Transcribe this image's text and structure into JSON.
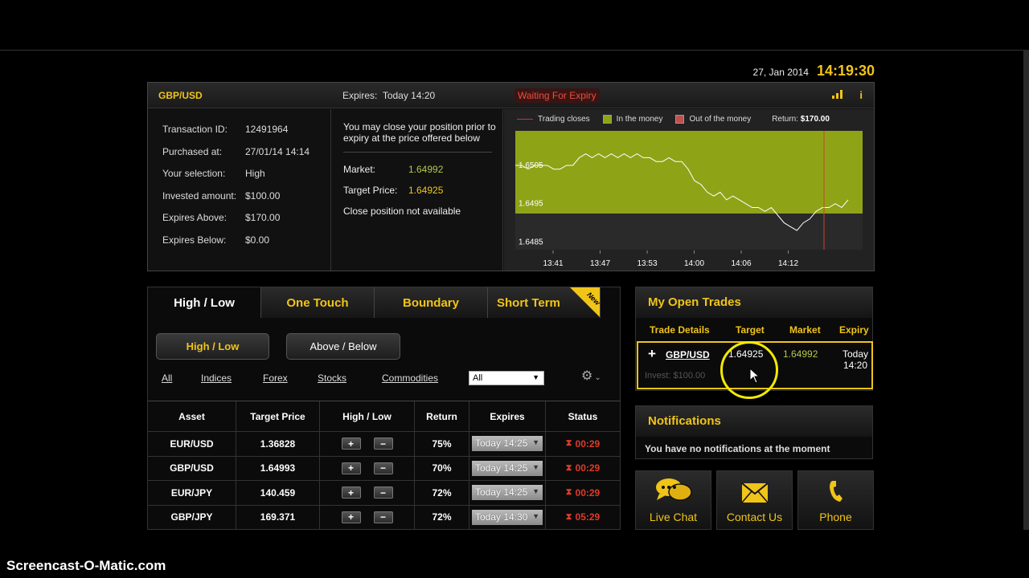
{
  "clock": {
    "date": "27, Jan 2014",
    "time": "14:19:30"
  },
  "detail": {
    "asset": "GBP/USD",
    "expires_label": "Expires:",
    "expires_value": "Today 14:20",
    "status": "Waiting For Expiry",
    "fields": [
      {
        "label": "Transaction ID:",
        "value": "12491964"
      },
      {
        "label": "Purchased at:",
        "value": "27/01/14 14:14"
      },
      {
        "label": "Your selection:",
        "value": "High"
      },
      {
        "label": "Invested amount:",
        "value": "$100.00"
      },
      {
        "label": "Expires Above:",
        "value": "$170.00"
      },
      {
        "label": "Expires Below:",
        "value": "$0.00"
      }
    ],
    "message": "You may close your position prior to expiry at the price offered below",
    "market_label": "Market:",
    "market_value": "1.64992",
    "target_label": "Target Price:",
    "target_value": "1.64925",
    "close_note": "Close position not available"
  },
  "chart_legend": {
    "trading_closes": "Trading closes",
    "in_money": "In the money",
    "out_money": "Out of the money",
    "return_label": "Return:",
    "return_value": "$170.00"
  },
  "chart_data": {
    "type": "line",
    "x_ticks": [
      "13:41",
      "13:47",
      "13:53",
      "14:00",
      "14:06",
      "14:12"
    ],
    "y_ticks": [
      "1.6505",
      "1.6495",
      "1.6485"
    ],
    "ylim": [
      1.6483,
      1.6514
    ],
    "target": 1.64925,
    "colors": {
      "in_money": "#8fa317",
      "out_money": "#2a2a2a",
      "line": "#ffffff",
      "close": "#d04030"
    },
    "series": [
      {
        "values": [
          1.6505,
          1.6505,
          1.6504,
          1.6505,
          1.6505,
          1.6505,
          1.6504,
          1.6504,
          1.6505,
          1.6505,
          1.6507,
          1.6508,
          1.6507,
          1.6508,
          1.6507,
          1.6508,
          1.6507,
          1.6508,
          1.6507,
          1.6508,
          1.6507,
          1.6507,
          1.6506,
          1.6506,
          1.6507,
          1.6506,
          1.6506,
          1.6504,
          1.6501,
          1.65,
          1.6498,
          1.6497,
          1.6498,
          1.6496,
          1.6497,
          1.6496,
          1.6495,
          1.6494,
          1.6494,
          1.6493,
          1.6494,
          1.6492,
          1.649,
          1.6489,
          1.6488,
          1.649,
          1.6491,
          1.6493,
          1.6494,
          1.6494,
          1.6495,
          1.6494,
          1.6496
        ]
      }
    ]
  },
  "tabs": [
    {
      "label": "High / Low"
    },
    {
      "label": "One Touch"
    },
    {
      "label": "Boundary"
    },
    {
      "label": "Short Term"
    }
  ],
  "new_badge": "New",
  "mode_buttons": {
    "high_low": "High / Low",
    "above_below": "Above / Below"
  },
  "filters": [
    "All",
    "Indices",
    "Forex",
    "Stocks",
    "Commodities"
  ],
  "filter_select": "All",
  "grid": {
    "headers": [
      "Asset",
      "Target Price",
      "High / Low",
      "Return",
      "Expires",
      "Status"
    ],
    "plus": "+",
    "minus": "−",
    "rows": [
      {
        "asset": "EUR/USD",
        "target": "1.36828",
        "return": "75%",
        "expires": "Today 14:25",
        "status": "00:29"
      },
      {
        "asset": "GBP/USD",
        "target": "1.64993",
        "return": "70%",
        "expires": "Today 14:25",
        "status": "00:29"
      },
      {
        "asset": "EUR/JPY",
        "target": "140.459",
        "return": "72%",
        "expires": "Today 14:25",
        "status": "00:29"
      },
      {
        "asset": "GBP/JPY",
        "target": "169.371",
        "return": "72%",
        "expires": "Today 14:30",
        "status": "05:29"
      }
    ]
  },
  "open_trades": {
    "title": "My Open Trades",
    "headers": [
      "Trade Details",
      "Target",
      "Market",
      "Expiry"
    ],
    "row": {
      "asset": "GBP/USD",
      "invest": "Invest: $100.00",
      "target": "1.64925",
      "market": "1.64992",
      "expiry": "Today 14:20"
    }
  },
  "notifications": {
    "title": "Notifications",
    "message": "You have no notifications at the moment"
  },
  "contact": {
    "live_chat": "Live Chat",
    "contact_us": "Contact Us",
    "phone": "Phone"
  },
  "watermark": "Screencast-O-Matic.com"
}
